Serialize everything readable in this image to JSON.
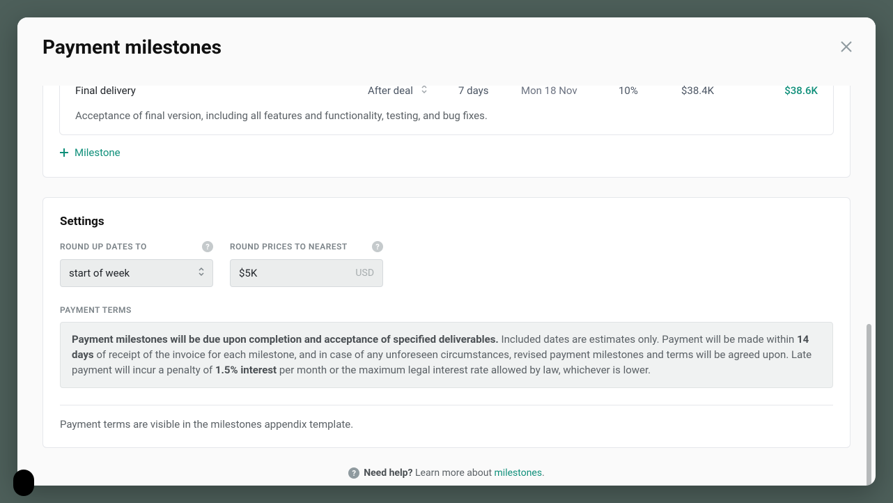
{
  "header": {
    "title": "Payment milestones"
  },
  "milestone": {
    "name": "Final delivery",
    "after": "After deal",
    "days": "7 days",
    "date": "Mon 18 Nov",
    "percent": "10%",
    "amount": "$38.4K",
    "total": "$38.6K",
    "description": "Acceptance of final version, including all features and functionality, testing, and bug fixes."
  },
  "addMilestone": {
    "label": "Milestone"
  },
  "settings": {
    "title": "Settings",
    "roundDates": {
      "label": "ROUND UP DATES TO",
      "value": "start of week"
    },
    "roundPrices": {
      "label": "ROUND PRICES TO NEAREST",
      "value": "$5K",
      "suffix": "USD"
    },
    "terms": {
      "label": "PAYMENT TERMS",
      "bold1": "Payment milestones will be due upon completion and acceptance of specified deliverables.",
      "text1": " Included dates are estimates only. Payment will be made within ",
      "bold2": "14 days",
      "text2": " of receipt of the invoice for each milestone, and in case of any unforeseen circumstances, revised payment milestones and terms will be agreed upon. Late payment will incur a penalty of ",
      "bold3": "1.5% interest",
      "text3": " per month or the maximum legal interest rate allowed by law, whichever is lower."
    },
    "note": "Payment terms are visible in the milestones appendix template."
  },
  "helpFooter": {
    "bold": "Need help?",
    "text": "Learn more about ",
    "link": "milestones",
    "period": "."
  }
}
